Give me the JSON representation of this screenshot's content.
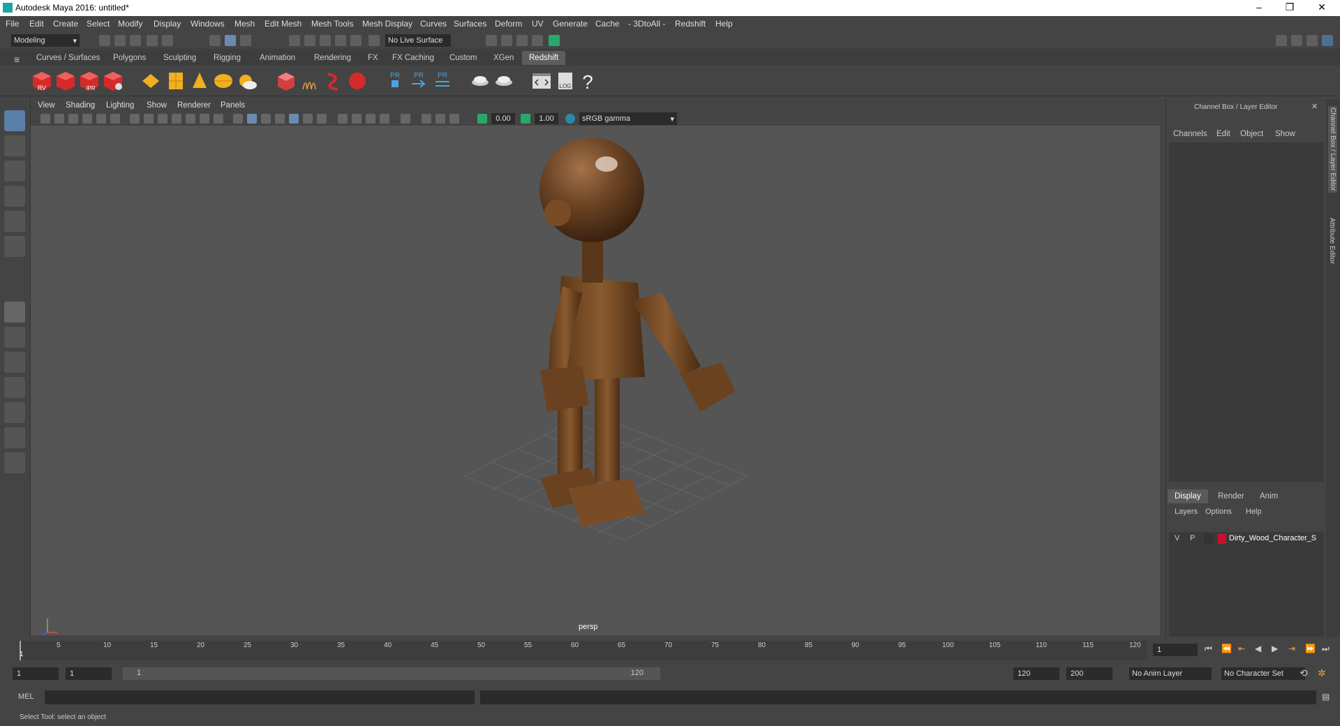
{
  "app": {
    "title": "Autodesk Maya 2016: untitled*"
  },
  "menus": [
    "File",
    "Edit",
    "Create",
    "Select",
    "Modify",
    "Display",
    "Windows",
    "Mesh",
    "Edit Mesh",
    "Mesh Tools",
    "Mesh Display",
    "Curves",
    "Surfaces",
    "Deform",
    "UV",
    "Generate",
    "Cache",
    "- 3DtoAll -",
    "Redshift",
    "Help"
  ],
  "status": {
    "mode": "Modeling",
    "live_surface": "No Live Surface"
  },
  "shelf_tabs": [
    "Curves / Surfaces",
    "Polygons",
    "Sculpting",
    "Rigging",
    "Animation",
    "Rendering",
    "FX",
    "FX Caching",
    "Custom",
    "XGen",
    "Redshift"
  ],
  "shelf_active": "Redshift",
  "shelf_labels": {
    "rv": "RV",
    "ipr": "IPR",
    "pr": "PR",
    "log": "LOG",
    "help": "?"
  },
  "viewport": {
    "menus": [
      "View",
      "Shading",
      "Lighting",
      "Show",
      "Renderer",
      "Panels"
    ],
    "exposure": "0.00",
    "gamma": "1.00",
    "color_space": "sRGB gamma",
    "camera": "persp"
  },
  "channel_box": {
    "title": "Channel Box / Layer Editor",
    "menus": [
      "Channels",
      "Edit",
      "Object",
      "Show"
    ],
    "layer_tabs": [
      "Display",
      "Render",
      "Anim"
    ],
    "layer_menus": [
      "Layers",
      "Options",
      "Help"
    ],
    "layer": {
      "v": "V",
      "p": "P",
      "name": "Dirty_Wood_Character_S",
      "color": "#c8102e"
    }
  },
  "side_tabs": [
    "Channel Box / Layer Editor",
    "Attribute Editor"
  ],
  "timeline": {
    "ticks": [
      "5",
      "10",
      "15",
      "20",
      "25",
      "30",
      "35",
      "40",
      "45",
      "50",
      "55",
      "60",
      "65",
      "70",
      "75",
      "80",
      "85",
      "90",
      "95",
      "100",
      "105",
      "110",
      "115",
      "120"
    ],
    "current_marker": "1",
    "current_frame": "1"
  },
  "range": {
    "start": "1",
    "inner_start": "1",
    "slider_start": "1",
    "slider_end": "120",
    "end": "120",
    "anim_end": "200",
    "anim_layer": "No Anim Layer",
    "char_set": "No Character Set"
  },
  "command": {
    "label": "MEL"
  },
  "help_line": "Select Tool: select an object"
}
